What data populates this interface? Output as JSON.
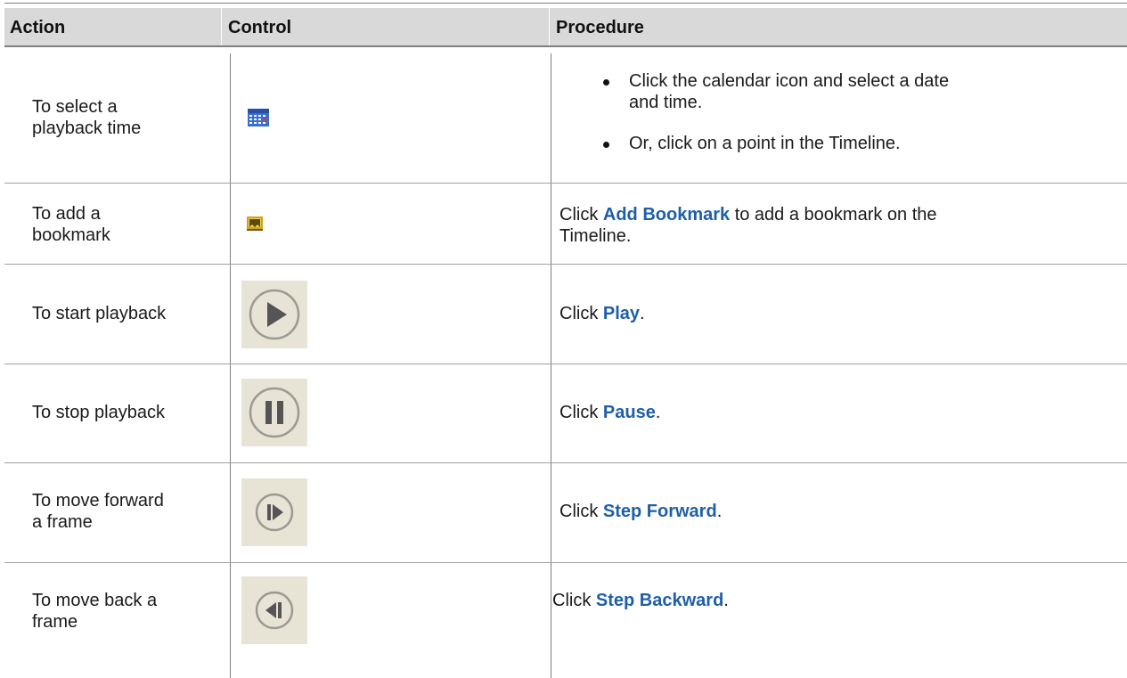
{
  "table": {
    "headers": {
      "action": "Action",
      "control": "Control",
      "procedure": "Procedure"
    },
    "rows": [
      {
        "action": "To select a\nplayback time",
        "control_icon": "calendar-icon",
        "procedure_bullets": [
          "Click the calendar icon and select a date\nand time.",
          "Or, click on a point in the Timeline."
        ]
      },
      {
        "action": "To add a\nbookmark",
        "control_icon": "bookmark-icon",
        "procedure_pre": "Click ",
        "procedure_bold": "Add Bookmark",
        "procedure_post": " to add a bookmark on the",
        "procedure_line2": "Timeline."
      },
      {
        "action": "To start playback",
        "control_icon": "play-icon",
        "procedure_pre": "Click ",
        "procedure_bold": "Play",
        "procedure_post": "."
      },
      {
        "action": "To stop playback",
        "control_icon": "pause-icon",
        "procedure_pre": "Click ",
        "procedure_bold": "Pause",
        "procedure_post": "."
      },
      {
        "action": "To move forward\na frame",
        "control_icon": "step-forward-icon",
        "procedure_pre": "Click ",
        "procedure_bold": "Step Forward",
        "procedure_post": "."
      },
      {
        "action": "To move back a\nframe",
        "control_icon": "step-backward-icon",
        "procedure_pre": "Click ",
        "procedure_bold": "Step Backward",
        "procedure_post": "."
      }
    ]
  },
  "colors": {
    "link": "#1f5fa8",
    "header_bg": "#d9d9d9",
    "control_bg": "#e7e4d6"
  }
}
